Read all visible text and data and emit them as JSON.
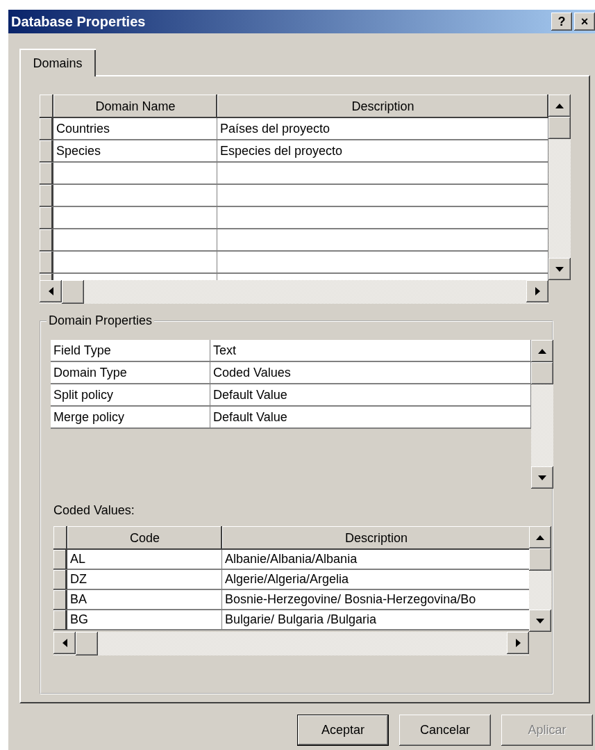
{
  "window": {
    "title": "Database Properties",
    "title_buttons": [
      "?",
      "×"
    ]
  },
  "tabs": [
    {
      "label": "Domains",
      "selected": true
    }
  ],
  "domains_table": {
    "columns": [
      "Domain Name",
      "Description"
    ],
    "rows": [
      {
        "name": "Countries",
        "description": "Países del proyecto"
      },
      {
        "name": "Species",
        "description": "Especies del proyecto"
      }
    ]
  },
  "domain_properties": {
    "title": "Domain Properties",
    "rows": [
      {
        "name": "Field Type",
        "value": "Text"
      },
      {
        "name": "Domain Type",
        "value": "Coded Values"
      },
      {
        "name": "Split policy",
        "value": "Default Value"
      },
      {
        "name": "Merge policy",
        "value": "Default Value"
      }
    ]
  },
  "coded_values": {
    "label": "Coded Values:",
    "columns": [
      "Code",
      "Description"
    ],
    "rows": [
      {
        "code": "AL",
        "description": "Albanie/Albania/Albania"
      },
      {
        "code": "DZ",
        "description": "Algerie/Algeria/Argelia"
      },
      {
        "code": "BA",
        "description": "Bosnie-Herzegovine/ Bosnia-Herzegovina/Bo"
      },
      {
        "code": "BG",
        "description": "Bulgarie/ Bulgaria /Bulgaria"
      }
    ]
  },
  "buttons": [
    {
      "label": "Aceptar",
      "default": true,
      "disabled": false
    },
    {
      "label": "Cancelar",
      "default": false,
      "disabled": false
    },
    {
      "label": "Aplicar",
      "default": false,
      "disabled": true
    }
  ]
}
